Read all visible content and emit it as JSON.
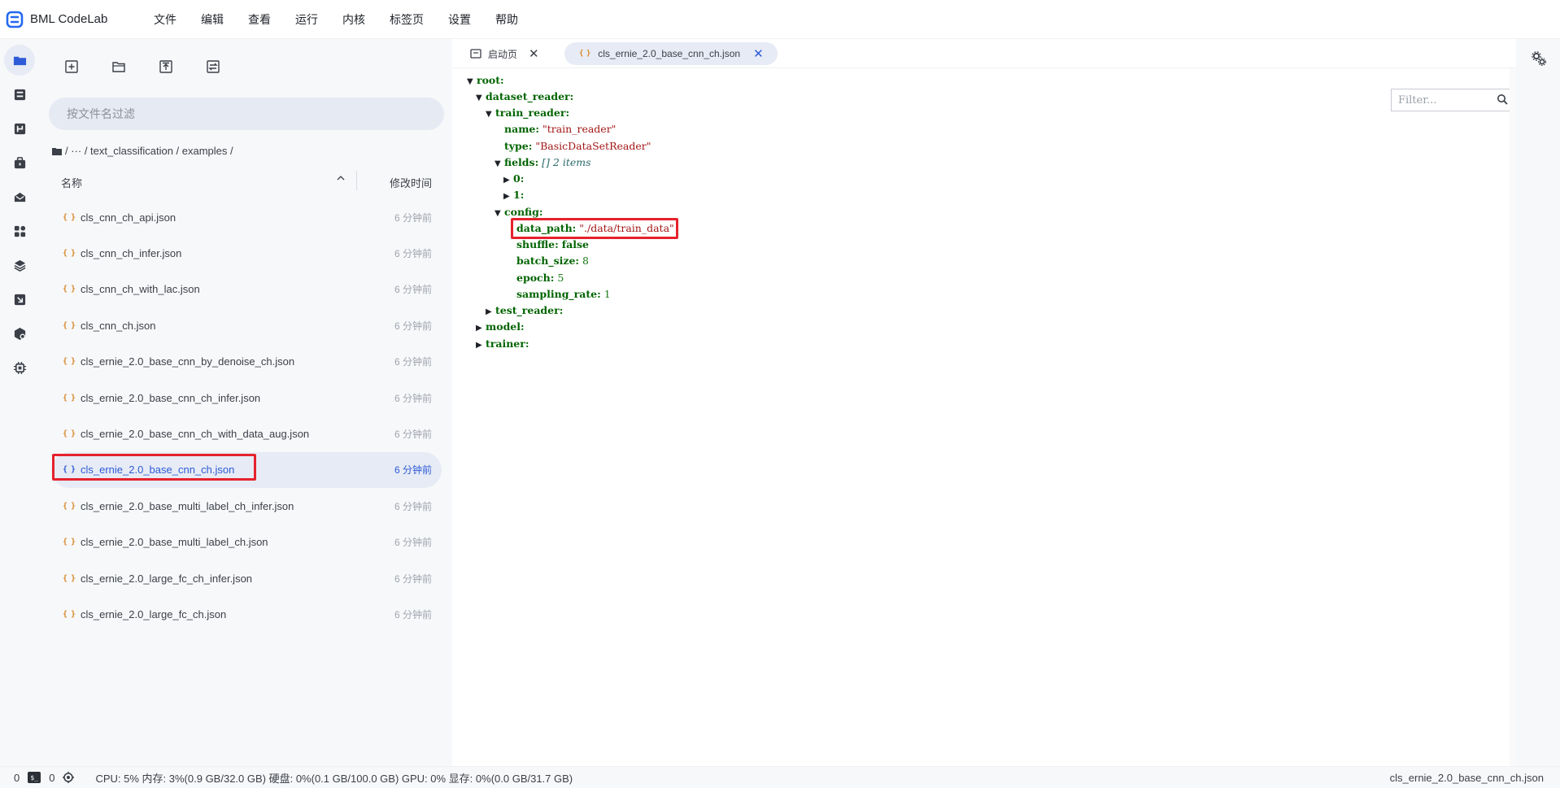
{
  "app": {
    "title": "BML CodeLab"
  },
  "menu": [
    "文件",
    "编辑",
    "查看",
    "运行",
    "内核",
    "标签页",
    "设置",
    "帮助"
  ],
  "sidebar": {
    "filter_placeholder": "按文件名过滤",
    "breadcrumb": "/ ··· / text_classification / examples /",
    "columns": {
      "name": "名称",
      "modified": "修改时间"
    },
    "files": [
      {
        "name": "cls_cnn_ch_api.json",
        "time": "6 分钟前"
      },
      {
        "name": "cls_cnn_ch_infer.json",
        "time": "6 分钟前"
      },
      {
        "name": "cls_cnn_ch_with_lac.json",
        "time": "6 分钟前"
      },
      {
        "name": "cls_cnn_ch.json",
        "time": "6 分钟前"
      },
      {
        "name": "cls_ernie_2.0_base_cnn_by_denoise_ch.json",
        "time": "6 分钟前"
      },
      {
        "name": "cls_ernie_2.0_base_cnn_ch_infer.json",
        "time": "6 分钟前"
      },
      {
        "name": "cls_ernie_2.0_base_cnn_ch_with_data_aug.json",
        "time": "6 分钟前"
      },
      {
        "name": "cls_ernie_2.0_base_cnn_ch.json",
        "time": "6 分钟前"
      },
      {
        "name": "cls_ernie_2.0_base_multi_label_ch_infer.json",
        "time": "6 分钟前"
      },
      {
        "name": "cls_ernie_2.0_base_multi_label_ch.json",
        "time": "6 分钟前"
      },
      {
        "name": "cls_ernie_2.0_large_fc_ch_infer.json",
        "time": "6 分钟前"
      },
      {
        "name": "cls_ernie_2.0_large_fc_ch.json",
        "time": "6 分钟前"
      }
    ]
  },
  "tabs": [
    {
      "label": "启动页",
      "close": "✕"
    },
    {
      "label": "cls_ernie_2.0_base_cnn_ch.json",
      "close": "✕"
    }
  ],
  "json_viewer": {
    "filter_placeholder": "Filter...",
    "lines": [
      {
        "caret": "▼",
        "key": "root:",
        "value": "",
        "vtype": ""
      },
      {
        "caret": "▼",
        "key": "dataset_reader:",
        "value": "",
        "vtype": ""
      },
      {
        "caret": "▼",
        "key": "train_reader:",
        "value": "",
        "vtype": ""
      },
      {
        "caret": "",
        "key": "name:",
        "value": "\"train_reader\"",
        "vtype": "s"
      },
      {
        "caret": "",
        "key": "type:",
        "value": "\"BasicDataSetReader\"",
        "vtype": "s"
      },
      {
        "caret": "▼",
        "key": "fields:",
        "value": "[] 2 items",
        "vtype": "arr"
      },
      {
        "caret": "▶",
        "key": "0:",
        "value": "",
        "vtype": ""
      },
      {
        "caret": "▶",
        "key": "1:",
        "value": "",
        "vtype": ""
      },
      {
        "caret": "▼",
        "key": "config:",
        "value": "",
        "vtype": ""
      },
      {
        "caret": "",
        "key": "data_path:",
        "value": "\"./data/train_data\"",
        "vtype": "s"
      },
      {
        "caret": "",
        "key": "shuffle:",
        "value": "false",
        "vtype": "b"
      },
      {
        "caret": "",
        "key": "batch_size:",
        "value": "8",
        "vtype": "n"
      },
      {
        "caret": "",
        "key": "epoch:",
        "value": "5",
        "vtype": "n"
      },
      {
        "caret": "",
        "key": "sampling_rate:",
        "value": "1",
        "vtype": "n"
      },
      {
        "caret": "▶",
        "key": "test_reader:",
        "value": "",
        "vtype": ""
      },
      {
        "caret": "▶",
        "key": "model:",
        "value": "",
        "vtype": ""
      },
      {
        "caret": "▶",
        "key": "trainer:",
        "value": "",
        "vtype": ""
      }
    ]
  },
  "status": {
    "left_num1": "0",
    "terminal_label": "$_",
    "left_num2": "0",
    "stats": "CPU:  5% 内存:  3%(0.9 GB/32.0 GB) 硬盘:  0%(0.1 GB/100.0 GB)  GPU:  0%  显存:  0%(0.0 GB/31.7 GB)",
    "current_file": "cls_ernie_2.0_base_cnn_ch.json"
  },
  "colors": {
    "accent": "#2e5bd8",
    "highlight": "#e5222d",
    "sidebar_bg": "#f7f8fa"
  }
}
